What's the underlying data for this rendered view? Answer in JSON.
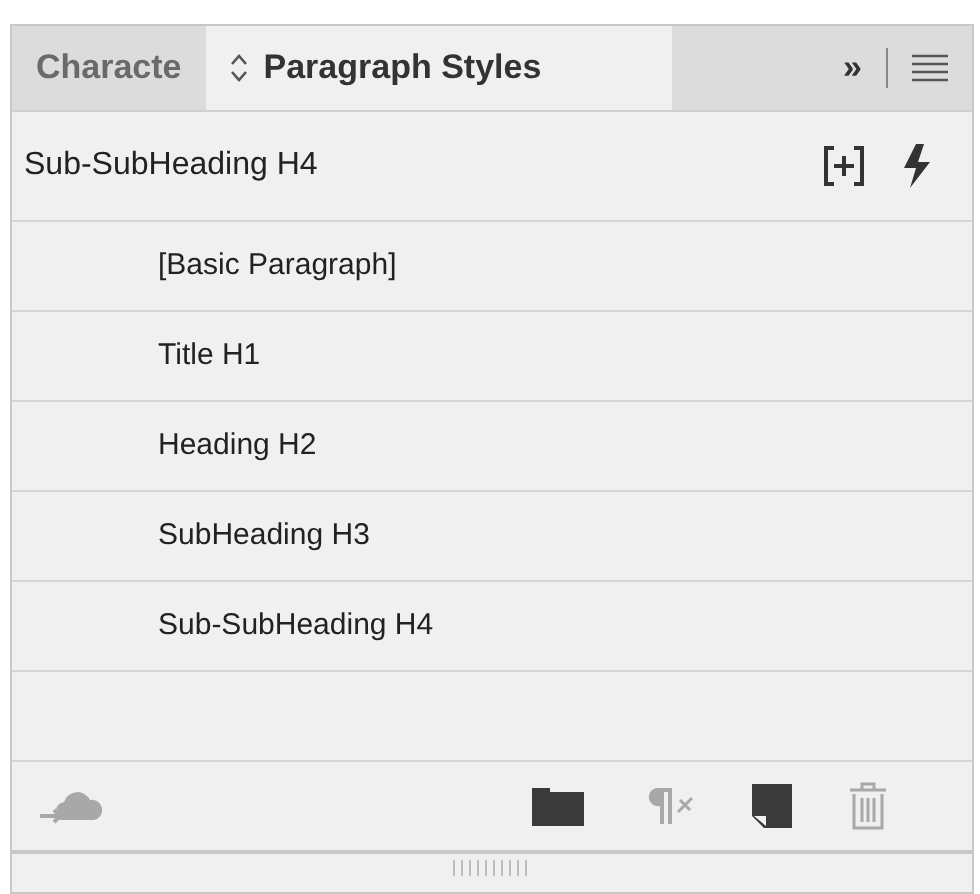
{
  "tabs": [
    {
      "label": "Characte",
      "selected": false,
      "stepper": false
    },
    {
      "label": "Paragraph Styles",
      "selected": true,
      "stepper": true
    }
  ],
  "tab_controls": {
    "overflow": "»"
  },
  "current_style": "Sub-SubHeading H4",
  "styles": [
    {
      "label": "[Basic Paragraph]"
    },
    {
      "label": "Title H1"
    },
    {
      "label": "Heading H2"
    },
    {
      "label": "SubHeading H3"
    },
    {
      "label": "Sub-SubHeading H4"
    }
  ],
  "toolbar": [
    {
      "kind": "cloud",
      "disabled": true
    },
    {
      "kind": "folder",
      "disabled": false
    },
    {
      "kind": "clear-overrides",
      "disabled": true
    },
    {
      "kind": "new-style",
      "disabled": false
    },
    {
      "kind": "trash",
      "disabled": true
    }
  ]
}
